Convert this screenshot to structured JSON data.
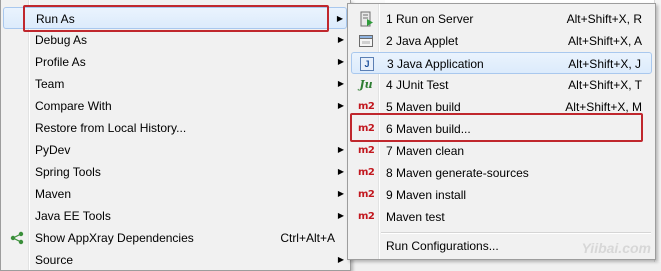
{
  "context_menu": {
    "items": [
      {
        "label": "Run As",
        "has_submenu": true
      },
      {
        "label": "Debug As",
        "has_submenu": true
      },
      {
        "label": "Profile As",
        "has_submenu": true
      },
      {
        "label": "Team",
        "has_submenu": true
      },
      {
        "label": "Compare With",
        "has_submenu": true
      },
      {
        "label": "Restore from Local History..."
      },
      {
        "label": "PyDev",
        "has_submenu": true
      },
      {
        "label": "Spring Tools",
        "has_submenu": true
      },
      {
        "label": "Maven",
        "has_submenu": true
      },
      {
        "label": "Java EE Tools",
        "has_submenu": true
      },
      {
        "label": "Show AppXray Dependencies",
        "shortcut": "Ctrl+Alt+A",
        "icon": "appxray-icon"
      },
      {
        "label": "Source",
        "has_submenu": true
      }
    ]
  },
  "run_as_submenu": {
    "items": [
      {
        "label": "1 Run on Server",
        "shortcut": "Alt+Shift+X, R",
        "icon": "server-icon"
      },
      {
        "label": "2 Java Applet",
        "shortcut": "Alt+Shift+X, A",
        "icon": "applet-icon"
      },
      {
        "label": "3 Java Application",
        "shortcut": "Alt+Shift+X, J",
        "icon": "java-app-icon",
        "icon_text": "J"
      },
      {
        "label": "4 JUnit Test",
        "shortcut": "Alt+Shift+X, T",
        "icon": "junit-icon",
        "icon_text": "Ju"
      },
      {
        "label": "5 Maven build",
        "shortcut": "Alt+Shift+X, M",
        "icon": "maven-icon",
        "icon_text": "m2"
      },
      {
        "label": "6 Maven build...",
        "icon": "maven-icon",
        "icon_text": "m2"
      },
      {
        "label": "7 Maven clean",
        "icon": "maven-icon",
        "icon_text": "m2"
      },
      {
        "label": "8 Maven generate-sources",
        "icon": "maven-icon",
        "icon_text": "m2"
      },
      {
        "label": "9 Maven install",
        "icon": "maven-icon",
        "icon_text": "m2"
      },
      {
        "label": "Maven test",
        "icon": "maven-icon",
        "icon_text": "m2"
      },
      {
        "label": "Run Configurations..."
      }
    ]
  },
  "watermark": "Yiibai.com",
  "colors": {
    "callout": "#c0272d",
    "maven": "#c2181f",
    "highlight": "#dcebfc"
  }
}
